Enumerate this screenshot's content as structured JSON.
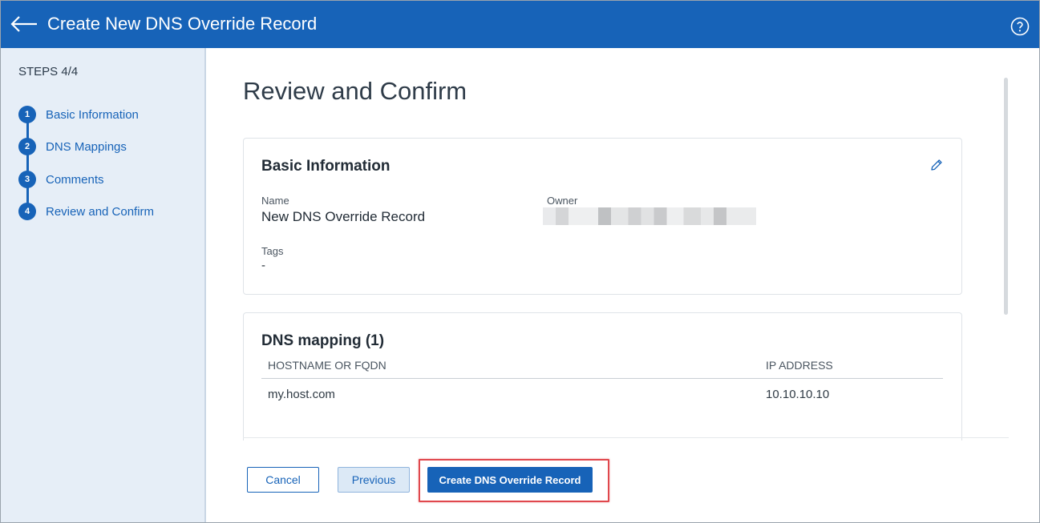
{
  "header": {
    "title": "Create New DNS Override Record",
    "back_icon": "arrow-left-icon",
    "help_icon": "question-circle-icon",
    "background": "#1763b8"
  },
  "sidebar": {
    "steps_title": "STEPS 4/4",
    "steps": [
      {
        "num": "1",
        "label": "Basic Information"
      },
      {
        "num": "2",
        "label": "DNS Mappings"
      },
      {
        "num": "3",
        "label": "Comments"
      },
      {
        "num": "4",
        "label": "Review and Confirm"
      }
    ]
  },
  "main": {
    "title": "Review and Confirm",
    "basic_info": {
      "title": "Basic Information",
      "edit_icon": "pencil-icon",
      "name_label": "Name",
      "name_value": "New DNS Override Record",
      "owner_label": "Owner",
      "tags_label": "Tags",
      "tags_value": "-"
    },
    "dns_mapping": {
      "title": "DNS mapping (1)",
      "columns": [
        "HOSTNAME OR FQDN",
        "IP ADDRESS"
      ],
      "rows": [
        [
          "my.host.com",
          "10.10.10.10"
        ]
      ]
    }
  },
  "footer": {
    "cancel_label": "Cancel",
    "previous_label": "Previous",
    "create_label": "Create DNS Override Record",
    "highlight_color": "#e0484d"
  }
}
